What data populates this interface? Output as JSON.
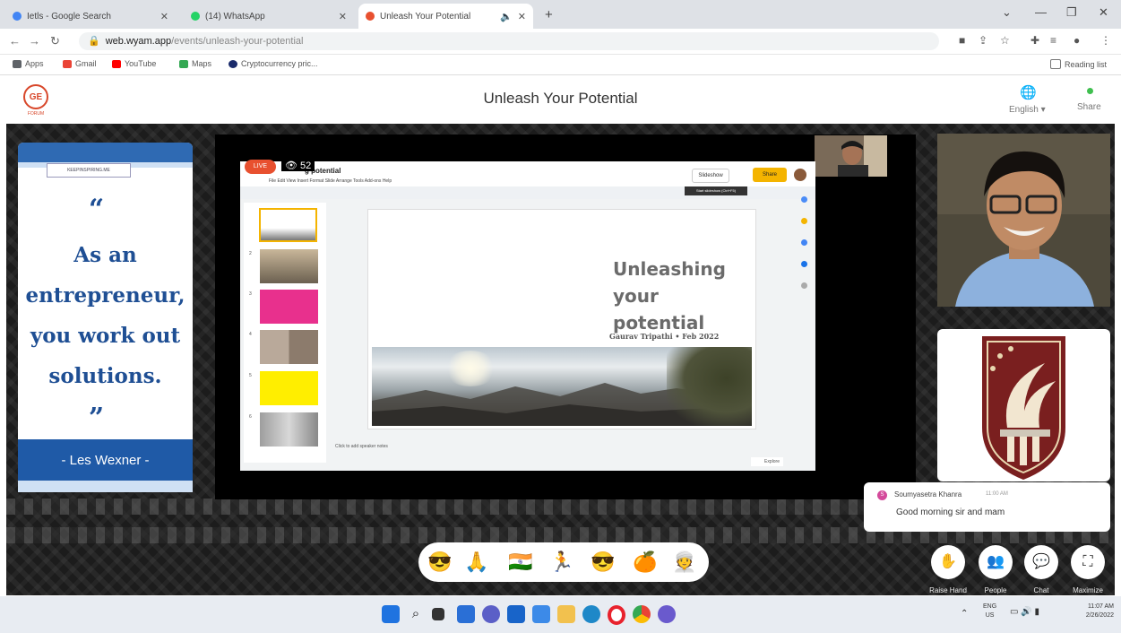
{
  "browser": {
    "tabs": [
      {
        "label": "Ietls - Google Search",
        "color": "#4285f4"
      },
      {
        "label": "(14) WhatsApp",
        "color": "#25d366"
      },
      {
        "label": "Unleash Your Potential",
        "color": "#e8502f"
      }
    ],
    "url_host": "web.wyam.app",
    "url_path": "/events/unleash-your-potential",
    "bookmarks": [
      {
        "label": "Apps",
        "color": "#5f6368"
      },
      {
        "label": "Gmail",
        "color": "#ea4335"
      },
      {
        "label": "YouTube",
        "color": "#ff0000"
      },
      {
        "label": "Maps",
        "color": "#34a853"
      },
      {
        "label": "Cryptocurrency pric...",
        "color": "#1a2b6b"
      }
    ],
    "reading_list": "Reading list"
  },
  "header": {
    "logo_text": "GE",
    "logo_sub": "FORUM",
    "title": "Unleash Your Potential",
    "language": "English",
    "share_label": "Share"
  },
  "quote_card": {
    "brand": "KEEPINSPIRING.ME",
    "open_mark": "“",
    "text": "As an entrepreneur, you work out solutions.",
    "close_mark": "”",
    "author": "- Les Wexner -"
  },
  "presentation": {
    "live_label": "LIVE",
    "viewer_count": "52",
    "doc_title": "g potential",
    "menu": "File  Edit  View  Insert  Format  Slide  Arrange  Tools  Add-ons  Help",
    "slideshow_label": "Slideshow",
    "share_label": "Share",
    "tooltip": "Start slideshow (Ctrl+F5)",
    "slide_title": "Unleashing your potential",
    "slide_subtitle": "Gaurav Tripathi • Feb 2022",
    "speaker_notes": "Click to add speaker notes",
    "explore_label": "Explore",
    "thumb_numbers": [
      "2",
      "3",
      "4",
      "5",
      "6"
    ]
  },
  "chat": {
    "avatar_letter": "S",
    "sender": "Soumyasetra Khanra",
    "time": "11:00 AM",
    "message": "Good morning sir and mam"
  },
  "reactions": [
    "😎",
    "🙏",
    "🇮🇳",
    "🏃",
    "😎",
    "🍊",
    "👳"
  ],
  "controls": [
    {
      "label": "Raise Hand",
      "icon": "✋"
    },
    {
      "label": "People",
      "icon": "👥"
    },
    {
      "label": "Chat",
      "icon": "💬"
    },
    {
      "label": "Maximize",
      "icon": "⛶"
    }
  ],
  "taskbar": {
    "lang_top": "ENG",
    "lang_bottom": "US",
    "time": "11:07 AM",
    "date": "2/26/2022"
  }
}
